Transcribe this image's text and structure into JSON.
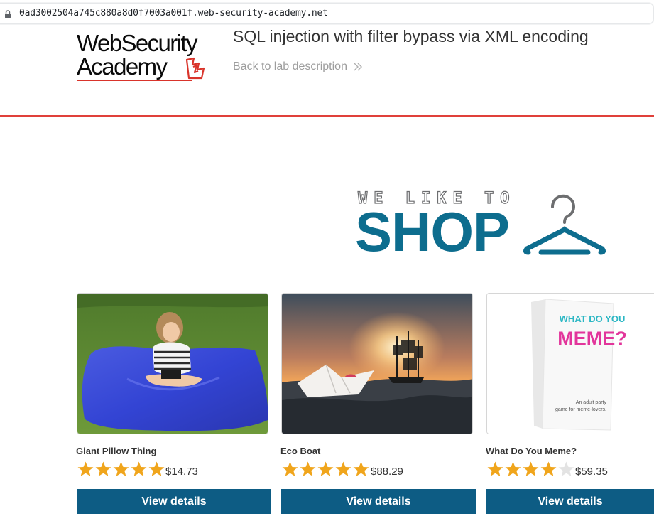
{
  "browser": {
    "url": "0ad3002504a745c880a8d0f7003a001f.web-security-academy.net"
  },
  "header": {
    "logo_line1": "WebSecurity",
    "logo_line2": "Academy",
    "lab_title": "SQL injection with filter bypass via XML encoding",
    "back_link": "Back to lab description"
  },
  "banner": {
    "tagline": "WE LIKE TO",
    "headline": "SHOP"
  },
  "colors": {
    "accent_red": "#e0403a",
    "button_blue": "#0d5c84",
    "shop_blue": "#0d6d8e",
    "star_gold": "#f0a51c"
  },
  "products": [
    {
      "name": "Giant Pillow Thing",
      "rating": 5,
      "price": "$14.73",
      "button": "View details"
    },
    {
      "name": "Eco Boat",
      "rating": 5,
      "price": "$88.29",
      "button": "View details"
    },
    {
      "name": "What Do You Meme?",
      "rating": 4,
      "price": "$59.35",
      "button": "View details",
      "box_text_1": "WHAT DO YOU",
      "box_text_2": "MEME?",
      "box_tagline_1": "An adult party",
      "box_tagline_2": "game for meme-lovers."
    }
  ]
}
